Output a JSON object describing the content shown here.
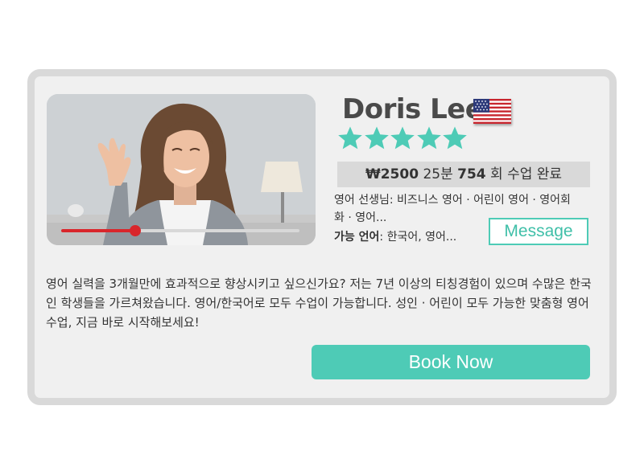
{
  "tutor": {
    "name": "Doris Lee",
    "flag_icon": "us-flag-icon",
    "rating_stars": 5,
    "rating_max": 5
  },
  "video": {
    "progress_fraction": 0.31
  },
  "stats": {
    "price": "₩2500",
    "duration": "25분",
    "lessons_count": "754",
    "lessons_suffix": "회 수업 완료"
  },
  "teaching": {
    "text": "영어 선생님: 비즈니스 영어 · 어린이 영어 · 영어회화 · 영어..."
  },
  "languages": {
    "label": "가능 언어",
    "value": ": 한국어, 영어..."
  },
  "buttons": {
    "message": "Message",
    "book": "Book Now"
  },
  "bio": "영어 실력을 3개월만에 효과적으로 향상시키고 싶으신가요? 저는 7년 이상의 티칭경험이 있으며 수많은 한국인 학생들을 가르쳐왔습니다. 영어/한국어로 모두 수업이 가능합니다. 성인 · 어린이 모두 가능한 맞춤형 영어 수업, 지금 바로 시작해보세요!",
  "colors": {
    "accent": "#4ecbb6",
    "progress": "#d9262b",
    "card_bg": "#f0f0f0",
    "card_border": "#d9d9d9"
  }
}
